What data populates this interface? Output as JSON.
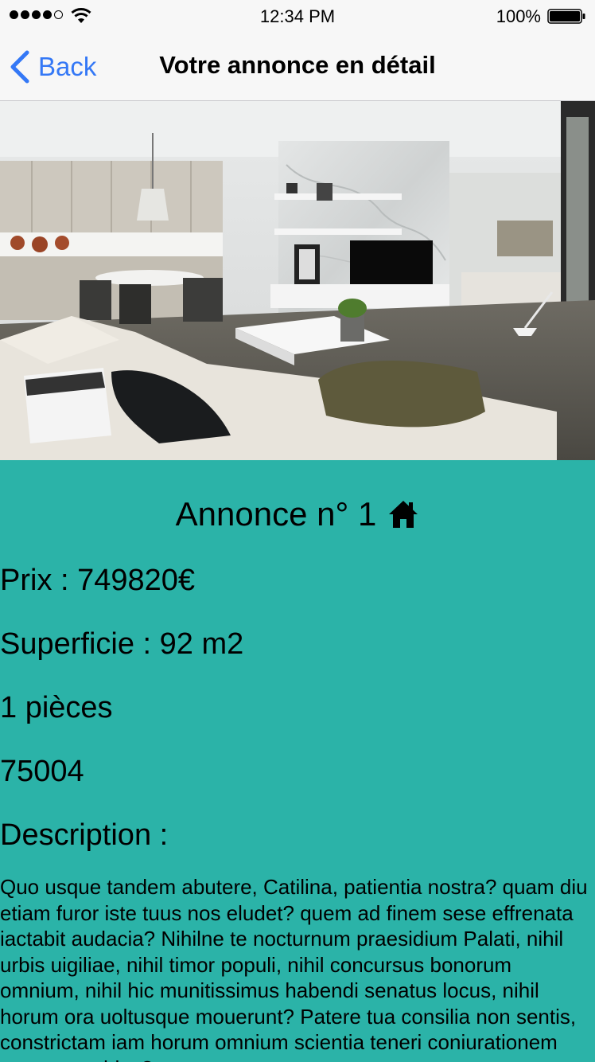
{
  "status_bar": {
    "time": "12:34 PM",
    "battery": "100%",
    "signal_icon": "signal-dots-icon",
    "wifi_icon": "wifi-icon",
    "battery_icon": "battery-icon"
  },
  "nav": {
    "back_label": "Back",
    "title": "Votre annonce en détail",
    "accent_color": "#3478f6"
  },
  "photo": {
    "subject": "modern open-plan living room interior"
  },
  "ad": {
    "title": "Annonce n° 1",
    "title_icon": "home-icon",
    "price_line": "Prix : 749820€",
    "surface_line": "Superficie : 92 m2",
    "rooms_line": "1 pièces",
    "postcode": "75004",
    "description_label": "Description :",
    "description": "Quo usque tandem abutere, Catilina, patientia nostra? quam diu etiam furor iste tuus nos eludet? quem ad finem sese effrenata iactabit audacia? Nihilne te nocturnum praesidium Palati, nihil urbis uigiliae, nihil timor populi, nihil concursus bonorum omnium, nihil hic munitissimus habendi senatus locus, nihil horum ora uoltusque mouerunt? Patere tua consilia non sentis, constrictam iam horum omnium scientia teneri coniurationem tuam non uides?"
  },
  "colors": {
    "background": "#2bb3a8",
    "bar_background": "#f7f7f7"
  }
}
